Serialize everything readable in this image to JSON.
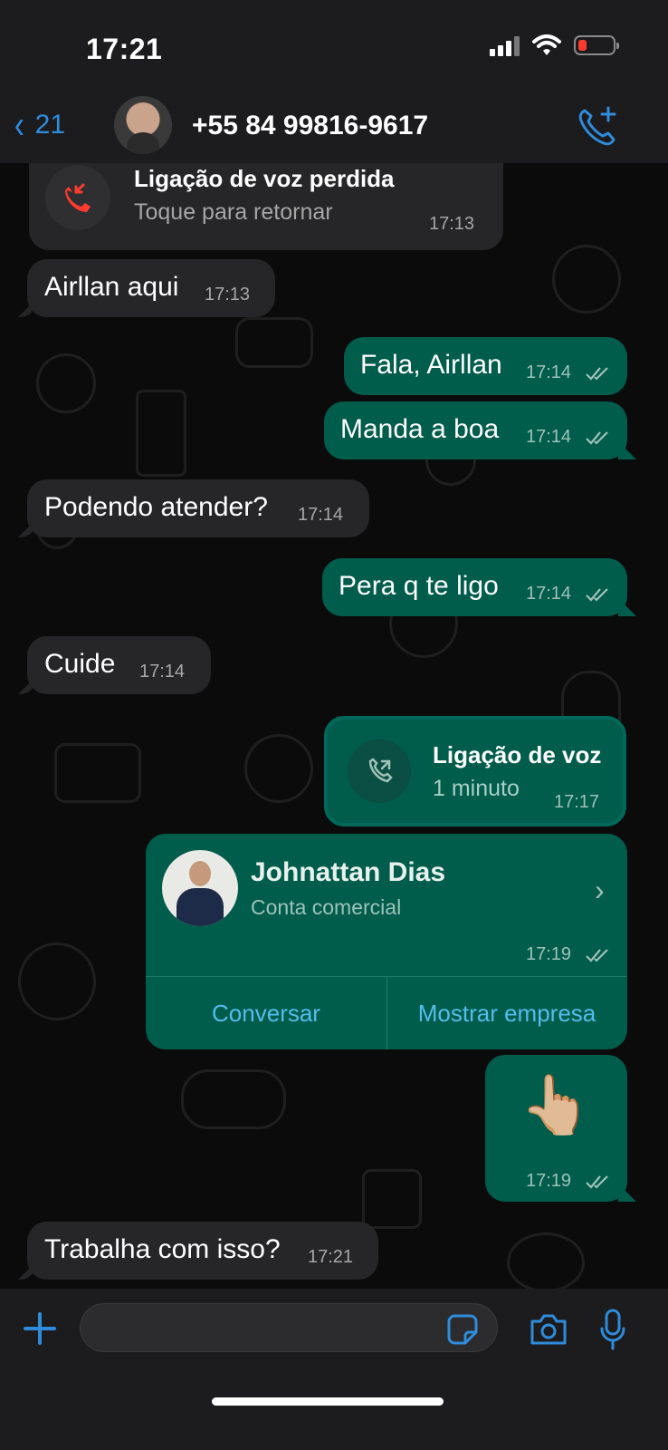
{
  "status_bar": {
    "time": "17:21"
  },
  "header": {
    "back_count": "21",
    "contact_name": "+55 84 99816-9617"
  },
  "messages": {
    "missed_call": {
      "title": "Ligação de voz perdida",
      "subtitle": "Toque para retornar",
      "time": "17:13"
    },
    "m1": {
      "text": "Airllan aqui",
      "time": "17:13"
    },
    "m2": {
      "text": "Fala, Airllan",
      "time": "17:14"
    },
    "m3": {
      "text": "Manda a boa",
      "time": "17:14"
    },
    "m4": {
      "text": "Podendo atender?",
      "time": "17:14"
    },
    "m5": {
      "text": "Pera q te ligo",
      "time": "17:14"
    },
    "m6": {
      "text": "Cuide",
      "time": "17:14"
    },
    "voice_call": {
      "title": "Ligação de voz",
      "subtitle": "1 minuto",
      "time": "17:17"
    },
    "contact_card": {
      "name": "Johnattan Dias",
      "subtitle": "Conta comercial",
      "time": "17:19",
      "button_chat": "Conversar",
      "button_business": "Mostrar empresa"
    },
    "emoji_msg": {
      "emoji": "👆🏼",
      "time": "17:19"
    },
    "m7": {
      "text": "Trabalha com isso?",
      "time": "17:21"
    }
  },
  "composer": {
    "placeholder": ""
  },
  "colors": {
    "accent": "#2f8cdb",
    "outgoing": "#005c4b",
    "incoming": "#262628",
    "missed": "#ff3b30",
    "link": "#53bdeb"
  },
  "icons": [
    "back-chevron-icon",
    "add-call-icon",
    "missed-call-icon",
    "phone-icon",
    "chevron-right-icon",
    "read-ticks-icon",
    "plus-icon",
    "sticker-icon",
    "camera-icon",
    "mic-icon",
    "signal-icon",
    "wifi-icon",
    "battery-icon"
  ]
}
